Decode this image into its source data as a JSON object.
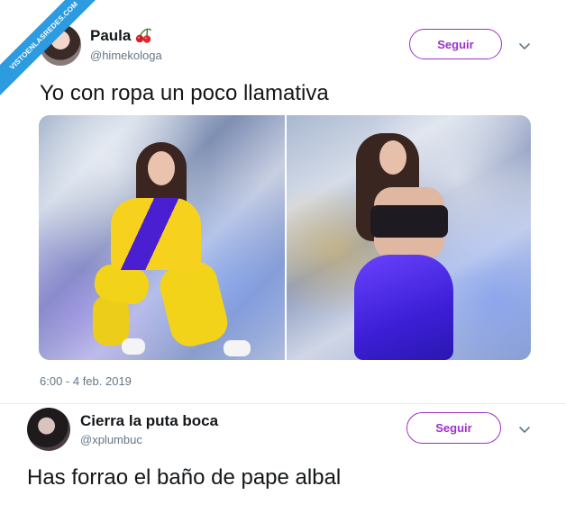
{
  "watermark": {
    "text": "VISTOENLASREDES.COM"
  },
  "tweet": {
    "author_name": "Paula",
    "author_handle": "@himekologa",
    "follow_label": "Seguir",
    "text": "Yo con ropa un poco llamativa",
    "timestamp": "6:00 - 4 feb. 2019",
    "media_count": 2
  },
  "reply": {
    "author_name": "Cierra la puta boca",
    "author_handle": "@xplumbuc",
    "follow_label": "Seguir",
    "text": "Has forrao el baño de pape albal"
  },
  "icons": {
    "name_emoji": "cherry-icon",
    "menu": "chevron-down-icon"
  },
  "colors": {
    "accent": "#9b32c8",
    "ribbon": "#2d9be0",
    "secondary_text": "#657786"
  }
}
